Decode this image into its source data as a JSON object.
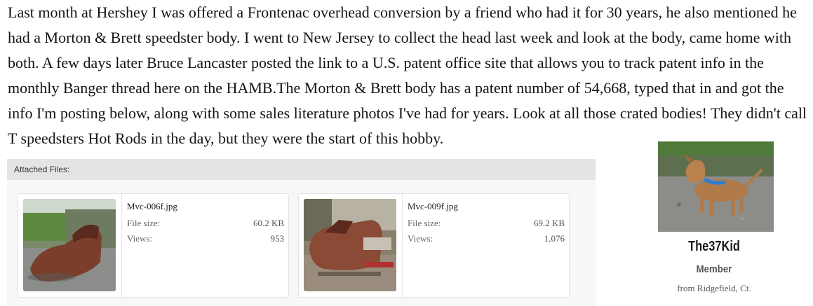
{
  "post": {
    "body": "Last month at Hershey I was offered a Frontenac overhead conversion by a friend who had it for 30 years, he also mentioned he had a Morton & Brett speedster body. I went to New Jersey to collect the head last week and look at the body, came home with both. A few days later Bruce Lancaster posted the link to a U.S. patent office site that allows you to track patent info in the monthly Banger thread here on the HAMB.The Morton & Brett body has a patent number of 54,668, typed that in and got the info I'm posting below, along with some sales literature photos I've had for years. Look at all those crated bodies! They didn't call T speedsters Hot Rods in the day, but they were the start of this hobby."
  },
  "attachments": {
    "header": "Attached Files:",
    "files": [
      {
        "name": "Mvc-006f.jpg",
        "size_label": "File size:",
        "size": "60.2 KB",
        "views_label": "Views:",
        "views": "953"
      },
      {
        "name": "Mvc-009f.jpg",
        "size_label": "File size:",
        "size": "69.2 KB",
        "views_label": "Views:",
        "views": "1,076"
      }
    ]
  },
  "user": {
    "name": "The37Kid",
    "title": "Member",
    "location": "from Ridgefield, Ct."
  }
}
